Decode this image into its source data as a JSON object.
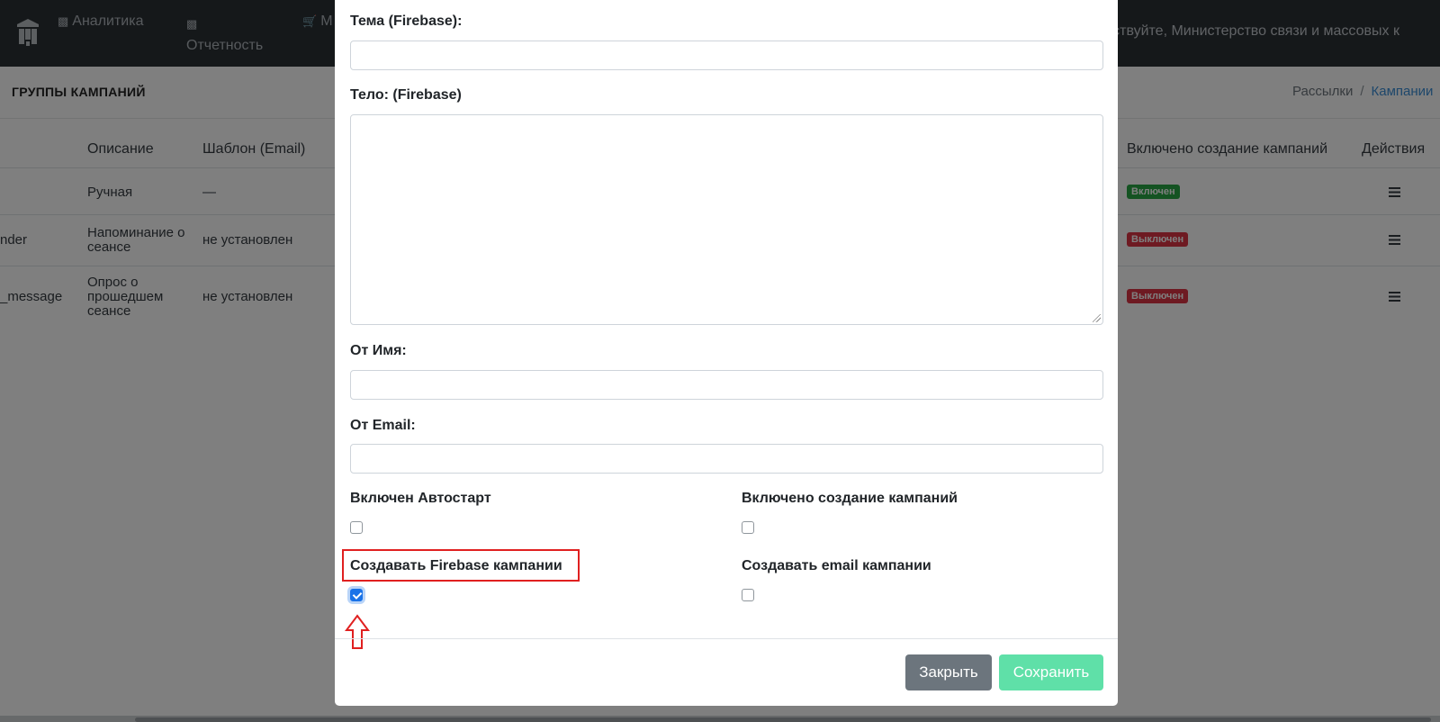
{
  "nav": {
    "analytics": "Аналитика",
    "reports": "Отчетность",
    "market_partial": "М",
    "greeting": "равствуйте, Министерство связи и массовых к"
  },
  "subheader": {
    "title": "ГРУППЫ КАМПАНИЙ",
    "breadcrumb": [
      "Рассылки",
      "Кампании"
    ]
  },
  "table": {
    "headers": {
      "description": "Описание",
      "template_email": "Шаблон (Email)",
      "campaigns_enabled": "Включено создание кампаний",
      "actions": "Действия"
    },
    "rows": [
      {
        "name_tail": "",
        "description": "Ручная",
        "template": "—",
        "dash": "–",
        "status": "Включен",
        "status_kind": "on"
      },
      {
        "name_tail": "nder",
        "description": "Напоминание о сеансе",
        "template": "не установлен",
        "status": "Выключен",
        "status_kind": "off"
      },
      {
        "name_tail": "_message",
        "description": "Опрос о прошедшем сеансе",
        "template": "не установлен",
        "status": "Выключен",
        "status_kind": "off"
      }
    ]
  },
  "modal": {
    "firebase_subject_label": "Тема (Firebase):",
    "firebase_body_label": "Тело: (Firebase)",
    "from_name_label": "От Имя:",
    "from_email_label": "От Email:",
    "autostart_label": "Включен Автостарт",
    "campaign_creation_label": "Включено создание кампаний",
    "create_firebase_label": "Создавать Firebase кампании",
    "create_email_label": "Создавать email кампании",
    "close_button": "Закрыть",
    "save_button": "Сохранить",
    "values": {
      "autostart": false,
      "campaign_creation": false,
      "create_firebase": true,
      "create_email": false
    }
  },
  "colors": {
    "topbar": "#2b3035",
    "badge_on": "#28a745",
    "badge_off": "#dc3545",
    "highlight": "#e02020",
    "checkbox_checked": "#1a73e8",
    "save_button": "#5fe0a8",
    "close_button": "#6c757d"
  },
  "icons": [
    "bar-chart-icon",
    "cart-icon",
    "list-icon",
    "resize-grip-icon",
    "check-icon",
    "up-arrow-icon"
  ]
}
